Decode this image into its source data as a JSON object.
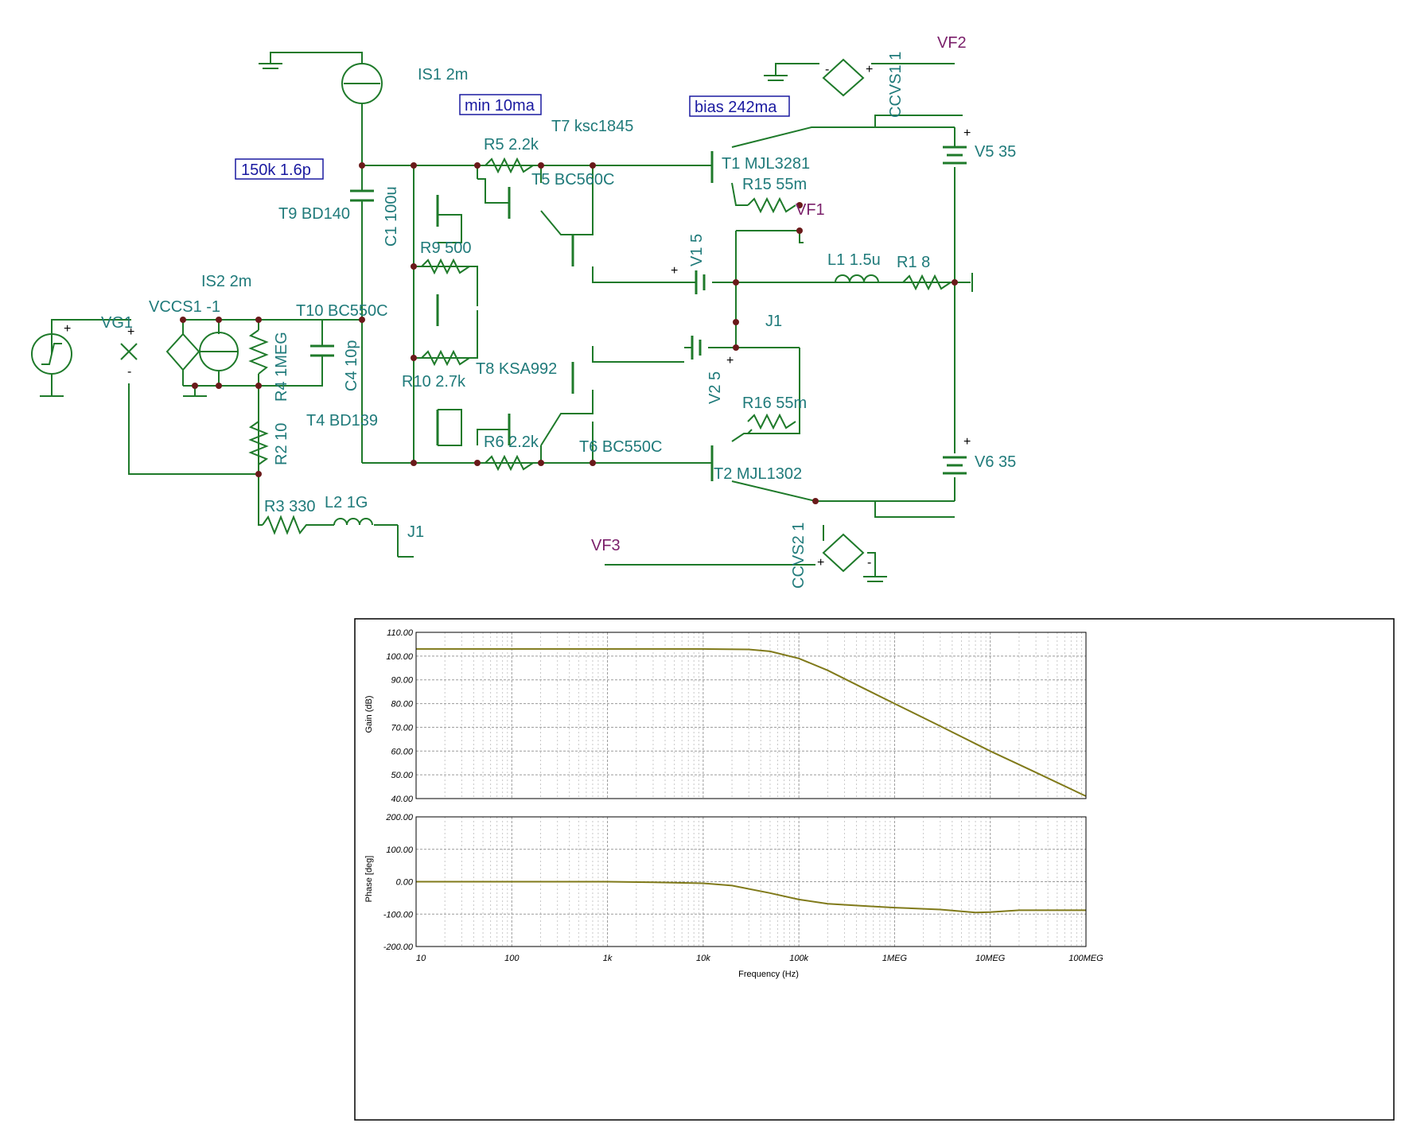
{
  "schematic": {
    "components": {
      "is1": "IS1 2m",
      "is2": "IS2 2m",
      "vccs1": "VCCS1 -1",
      "vg1": "VG1",
      "t10": "T10 BC550C",
      "t9": "T9 BD140",
      "t4": "T4 BD139",
      "c1": "C1 100u",
      "c4": "C4 10p",
      "r4": "R4 1MEG",
      "r2": "R2 10",
      "r3": "R3 330",
      "l2": "L2 1G",
      "j1_left": "J1",
      "r9": "R9 500",
      "r10": "R10 2.7k",
      "t8": "T8 KSA992",
      "r5": "R5 2.2k",
      "t5": "T5 BC560C",
      "t7": "T7 ksc1845",
      "r6": "R6 2.2k",
      "t6": "T6 BC550C",
      "v1": "V1 5",
      "v2": "V2 5",
      "j1_mid": "J1",
      "t1": "T1 MJL3281",
      "r15": "R15 55m",
      "t2": "T2 MJL1302",
      "r16": "R16 55m",
      "l1": "L1 1.5u",
      "r1": "R1 8",
      "v5": "V5 35",
      "v6": "V6 35",
      "ccvs1": "CCVS1 1",
      "ccvs2": "CCVS2 1"
    },
    "probes": {
      "vf1": "VF1",
      "vf2": "VF2",
      "vf3": "VF3"
    },
    "notes": {
      "min_current": "min 10ma",
      "bias": "bias 242ma",
      "compensation": "150k 1.6p"
    },
    "colors": {
      "wire": "#1e7a2a",
      "label": "#1f7a7a",
      "probe": "#7a1f6a",
      "note": "#1a1aa0"
    }
  },
  "chart_data": [
    {
      "type": "line",
      "ylabel": "Gain (dB)",
      "xlabel": "",
      "x_scale": "log",
      "xlim": [
        10,
        100000000
      ],
      "ylim": [
        40,
        110
      ],
      "yticks": [
        "110.00",
        "100.00",
        "90.00",
        "80.00",
        "70.00",
        "60.00",
        "50.00",
        "40.00"
      ],
      "grid": true,
      "line_color": "#807a1a",
      "series": [
        {
          "x": [
            10,
            100,
            1000,
            10000,
            30000,
            50000,
            100000,
            200000,
            500000,
            1000000,
            3000000,
            10000000,
            30000000,
            100000000
          ],
          "y": [
            103,
            103,
            103,
            103,
            102.8,
            102,
            99,
            94,
            86,
            80,
            70.5,
            60,
            51,
            41
          ]
        }
      ]
    },
    {
      "type": "line",
      "ylabel": "Phase [deg]",
      "xlabel": "Frequency (Hz)",
      "x_scale": "log",
      "xlim": [
        10,
        100000000
      ],
      "ylim": [
        -200,
        200
      ],
      "yticks": [
        "200.00",
        "100.00",
        "0.00",
        "-100.00",
        "-200.00"
      ],
      "xticks": [
        "10",
        "100",
        "1k",
        "10k",
        "100k",
        "1MEG",
        "10MEG",
        "100MEG"
      ],
      "grid": true,
      "line_color": "#807a1a",
      "series": [
        {
          "x": [
            10,
            100,
            1000,
            3000,
            10000,
            20000,
            50000,
            100000,
            200000,
            500000,
            1000000,
            3000000,
            7000000,
            10000000,
            20000000,
            100000000
          ],
          "y": [
            0,
            0,
            0,
            -2,
            -5,
            -12,
            -35,
            -55,
            -68,
            -75,
            -80,
            -86,
            -95,
            -94,
            -88,
            -88
          ]
        }
      ]
    }
  ]
}
